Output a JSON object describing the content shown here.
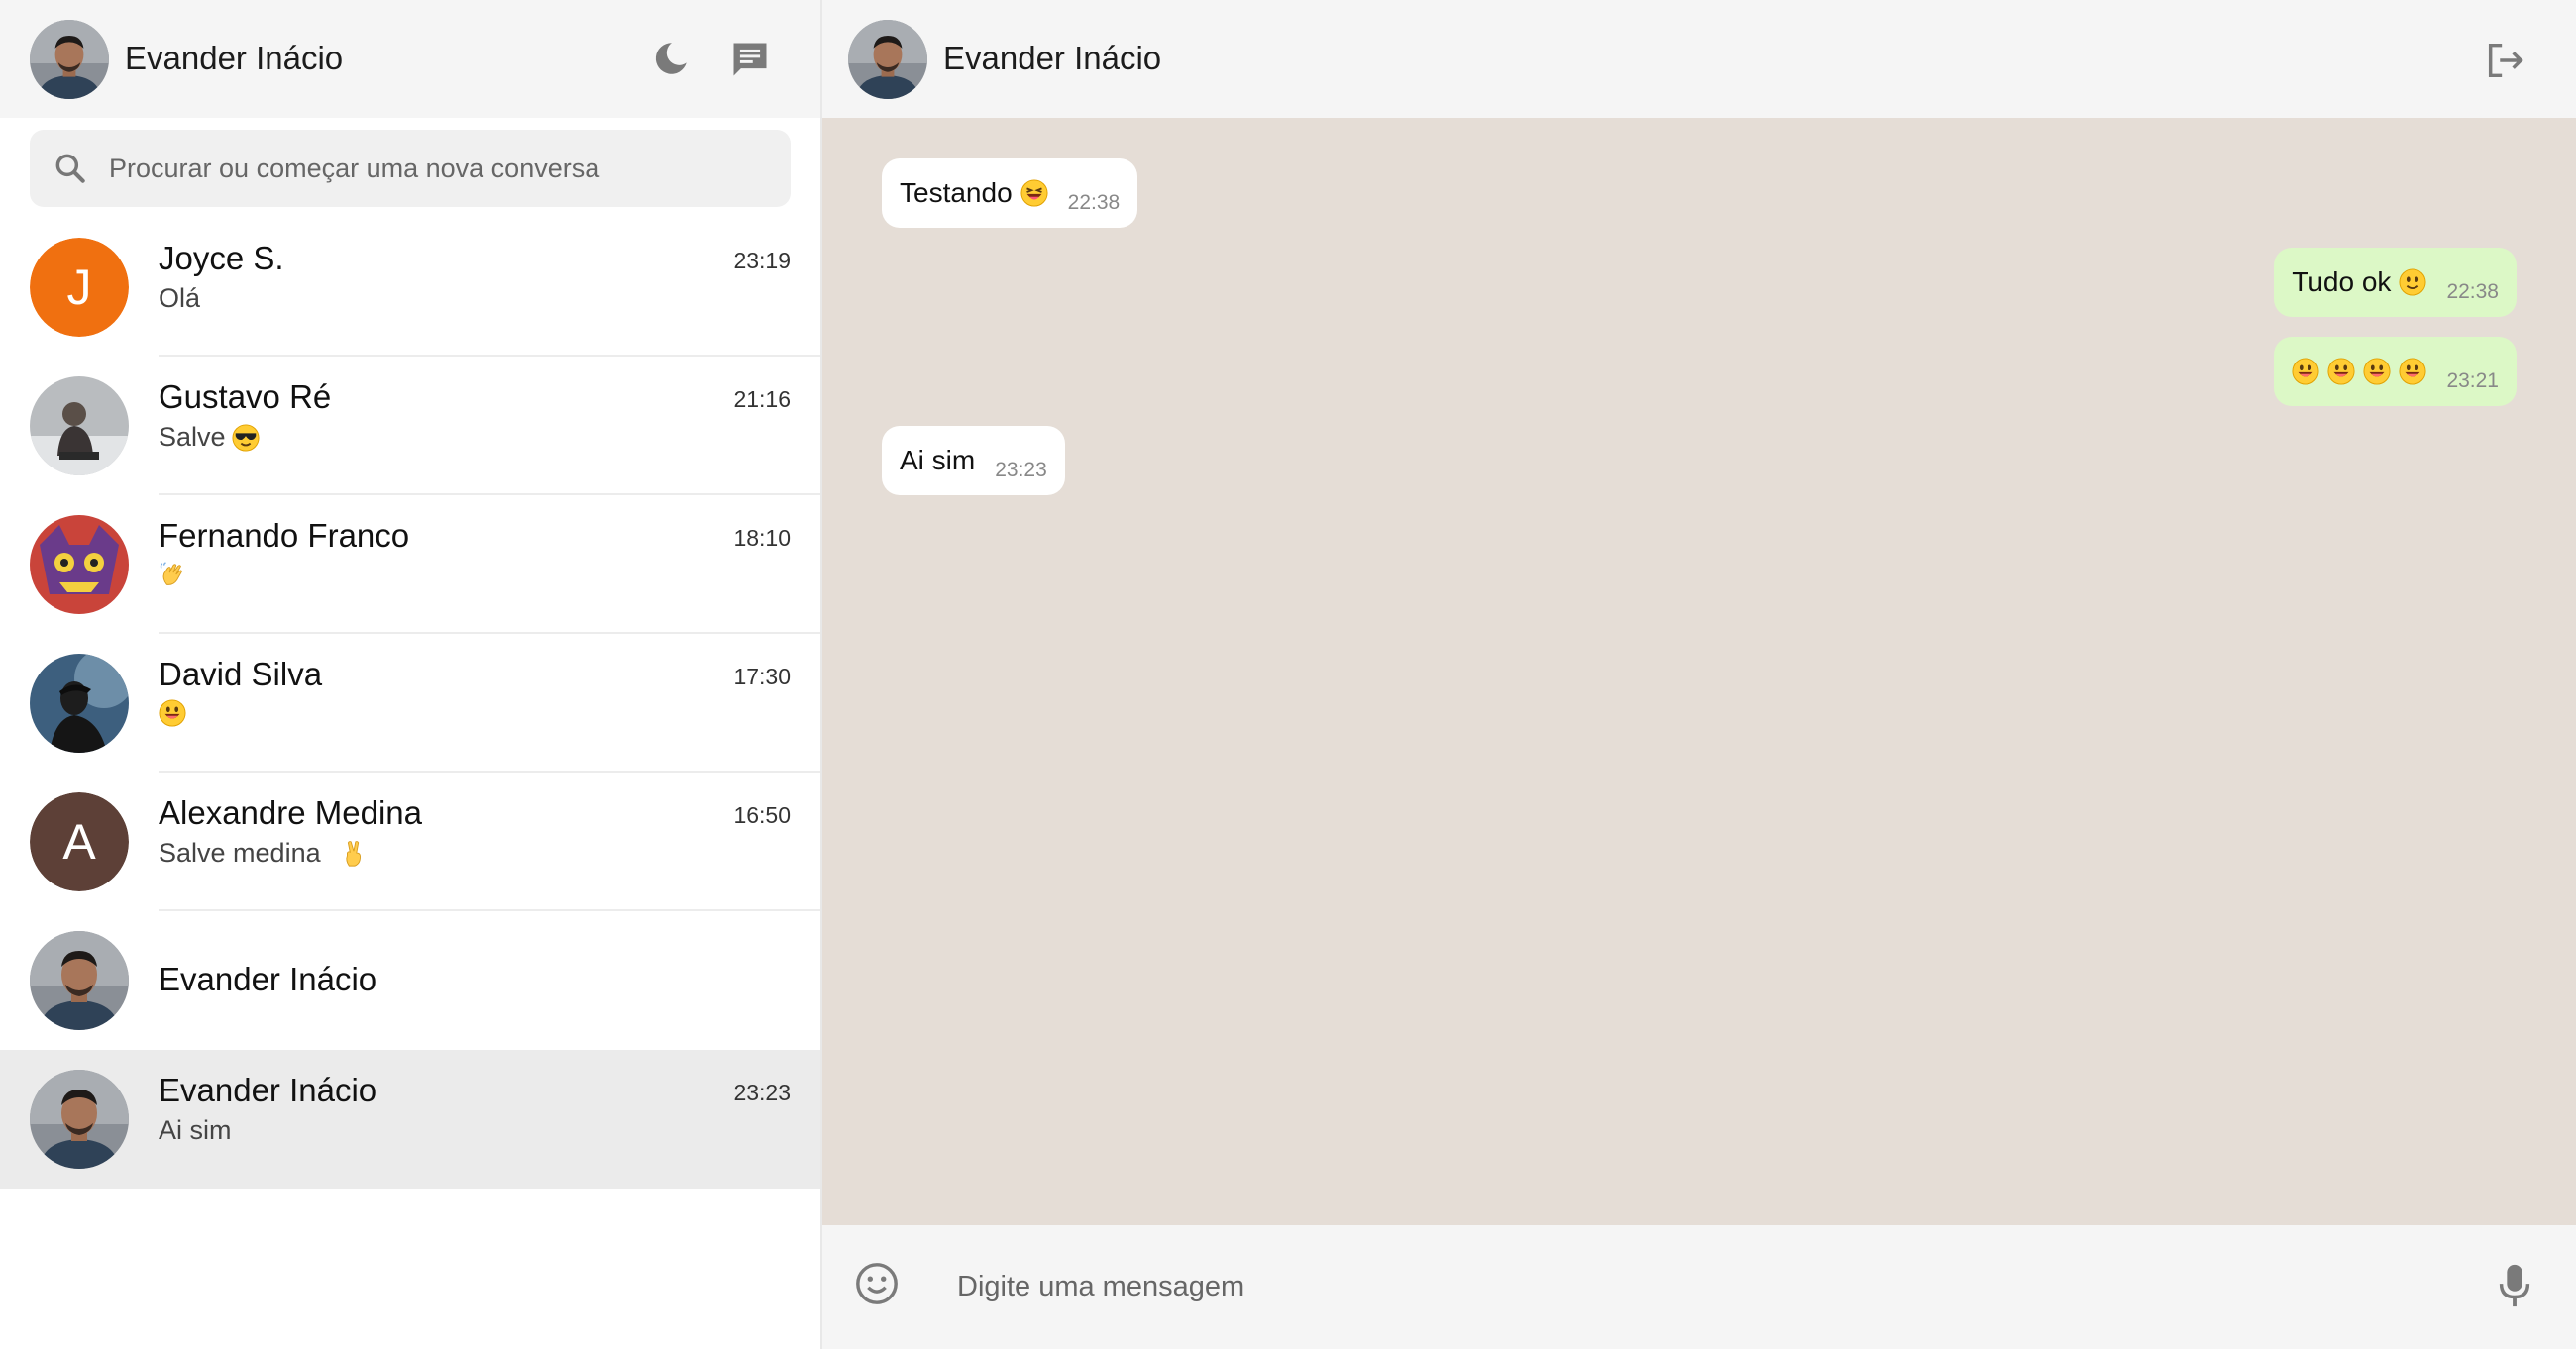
{
  "user": {
    "name": "Evander Inácio"
  },
  "search": {
    "placeholder": "Procurar ou começar uma nova conversa"
  },
  "chats": [
    {
      "name": "Joyce S.",
      "time": "23:19",
      "last": "Olá",
      "avatar_letter": "J",
      "avatar_color": "#f07010"
    },
    {
      "name": "Gustavo Ré",
      "time": "21:16",
      "last": "Salve",
      "last_emoji": "sunglasses-emoji"
    },
    {
      "name": "Fernando Franco",
      "time": "18:10",
      "last": "",
      "last_emoji": "waving-hand-emoji"
    },
    {
      "name": "David Silva",
      "time": "17:30",
      "last": "",
      "last_emoji": "grinning-emoji"
    },
    {
      "name": "Alexandre Medina",
      "time": "16:50",
      "last": "Salve medina",
      "last_emoji": "victory-hand-emoji",
      "avatar_letter": "A",
      "avatar_color": "#5d4037"
    },
    {
      "name": "Evander Inácio"
    },
    {
      "name": "Evander Inácio",
      "time": "23:23",
      "last": "Ai sim",
      "active": true
    }
  ],
  "chat": {
    "title": "Evander Inácio",
    "messages": [
      {
        "text": "Testando",
        "emoji": [
          "laughing-emoji"
        ],
        "time": "22:38",
        "direction": "in"
      },
      {
        "text": "Tudo ok",
        "emoji": [
          "slight-smile-emoji"
        ],
        "time": "22:38",
        "direction": "out"
      },
      {
        "text": "",
        "emoji": [
          "grinning-emoji",
          "grinning-emoji",
          "grinning-emoji",
          "grinning-emoji"
        ],
        "time": "23:21",
        "direction": "out"
      },
      {
        "text": "Ai sim",
        "emoji": [],
        "time": "23:23",
        "direction": "in"
      }
    ]
  },
  "composer": {
    "placeholder": "Digite uma mensagem"
  },
  "colors": {
    "sidebar_header": "#f5f5f5",
    "chat_bg": "#e5ddd6",
    "outgoing_bubble": "#dcf8c6",
    "incoming_bubble": "#ffffff",
    "active_chat": "#ebebeb"
  }
}
